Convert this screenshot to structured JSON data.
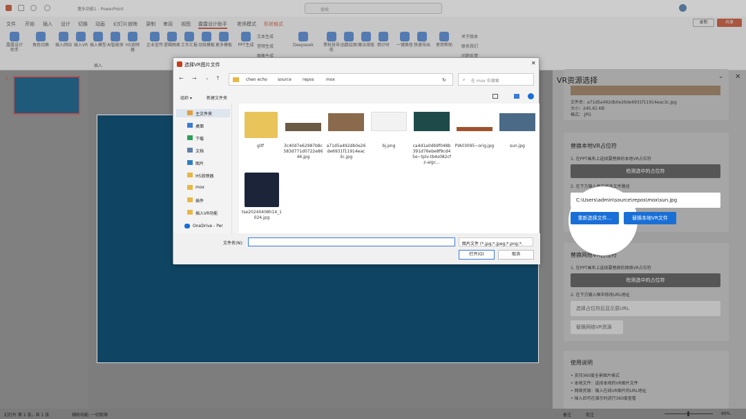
{
  "window": {
    "title": "蓬乐功能1 - PowerPoint",
    "search": "搜索",
    "record": "录制",
    "share": "共享"
  },
  "tabs": [
    "文件",
    "开始",
    "插入",
    "设计",
    "切换",
    "动画",
    "幻灯片放映",
    "录制",
    "审阅",
    "视图",
    "露露设计助手",
    "老师模式",
    "形状格式"
  ],
  "ribbon": {
    "items": [
      "露露设计助手",
      "角色切换",
      "插入网站",
      "插入VR",
      "插入模型",
      "AI智能体",
      "H5放映器",
      "企业宣传",
      "逻辑图表",
      "工作汇报",
      "动效模板",
      "更多模板",
      "PPT生成",
      "Deepseek",
      "黑科技导航",
      "函数绘图",
      "魔法排版",
      "倒计时",
      "一键换色",
      "快速导出",
      "使用帮助"
    ],
    "mini": [
      "文本生成",
      "音频生成",
      "图像生成",
      "关于版本",
      "联系我们",
      "问题反馈"
    ],
    "group_label": "插入"
  },
  "thumb": {
    "number": "1"
  },
  "dialog": {
    "title": "选择VR图片文件",
    "breadcrumb": [
      "chen echo",
      "source",
      "repos",
      "mox"
    ],
    "search_placeholder": "在 mox 中搜索",
    "organize": "组织 ▾",
    "new_folder": "新建文件夹",
    "tree": [
      {
        "label": "主文件夹",
        "icon": "home-icon"
      },
      {
        "label": "桌面",
        "icon": "desktop-icon"
      },
      {
        "label": "下载",
        "icon": "download-icon"
      },
      {
        "label": "文档",
        "icon": "document-icon"
      },
      {
        "label": "图片",
        "icon": "picture-icon"
      },
      {
        "label": "H5放映器",
        "icon": "folder-icon"
      },
      {
        "label": "mox",
        "icon": "folder-icon"
      },
      {
        "label": "插件",
        "icon": "folder-icon"
      },
      {
        "label": "插入VR功能",
        "icon": "folder-icon"
      },
      {
        "label": "OneDrive - Per",
        "icon": "cloud-icon"
      }
    ],
    "files": [
      {
        "name": "gitf"
      },
      {
        "name": "3c40d7e62987b8c583d771d0722e8646.jpg"
      },
      {
        "name": "a71d5a492db0e26de6931f11914eac3c.jpg"
      },
      {
        "name": "bj.png"
      },
      {
        "name": "ca4d1a0db9f048b391d76ebe8f9cd45e~tplv-tb4s082cfz-aigc..."
      },
      {
        "name": "PIA03095~orig.jpg"
      },
      {
        "name": "sun.jpg"
      },
      {
        "name": "tse20240408h14_1024.jpg"
      }
    ],
    "filename_label": "文件名(N):",
    "filename_value": "",
    "filetype": "图片文件 (*.jpg;*.jpeg;*.png;*.",
    "open": "打开(O)",
    "cancel": "取消"
  },
  "pane": {
    "title": "VR资源选择",
    "file_info": [
      "文件名：a71d5a492db0e26de6931f11914eac3c.jpg",
      "大小：245.61 KB",
      "格式：.JPG"
    ],
    "local_title": "替换本地VR占位符",
    "local_step1": "1. 在PPT画布上选择要替换的本地VR占位符",
    "detect_btn": "检测选中的占位符",
    "local_step2": "2. 在下方输入框中修改文件路径",
    "path_value": "C:\\Users\\admin\\source\\repos\\mox\\sun.jpg",
    "reselect_btn": "重新选择文件...",
    "replace_btn": "替换本地VR文件",
    "net_title": "替换网络VR占位符",
    "net_step1": "1. 在PPT画布上选择要替换的网络VR占位符",
    "net_detect_btn": "检测选中的占位符",
    "net_step2": "2. 在下方输入框中修改URL地址",
    "url_placeholder": "选择占位符后显示原URL",
    "net_replace_btn": "替换网络VR资源",
    "help_title": "使用说明",
    "help_items": [
      "• 支持360度全景图片格式",
      "• 本地文件：选择本地的VR图片文件",
      "• 网络资源：输入在线VR图片的URL地址",
      "• 插入后可在演示时进行360度查看"
    ]
  },
  "status": {
    "left": "幻灯片 第 1 张，共 1 张",
    "access": "辅助功能: 一切就绪",
    "notes": "备注",
    "comments": "批注",
    "zoom": "89%"
  }
}
